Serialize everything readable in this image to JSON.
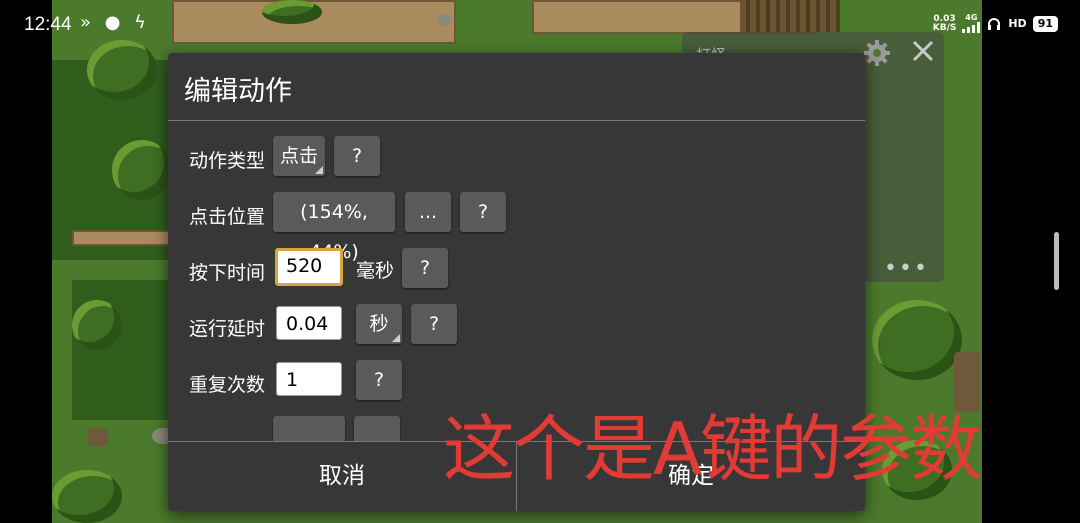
{
  "status_bar": {
    "time": "12:44",
    "left_icons": "» ● ϟ",
    "net_speed_value": "0.03",
    "net_speed_unit": "KB/S",
    "network_type": "4G",
    "hd_label": "HD",
    "battery": "91"
  },
  "background_panel": {
    "title": "打怪 ·"
  },
  "dialog": {
    "title": "编辑动作",
    "rows": [
      {
        "label": "动作类型",
        "value": "点击",
        "help": "?"
      },
      {
        "label": "点击位置",
        "value": "(154%, 44%)",
        "more": "...",
        "help": "?"
      },
      {
        "label": "按下时间",
        "value": "520",
        "unit": "毫秒",
        "help": "?"
      },
      {
        "label": "运行延时",
        "value": "0.04",
        "unit": "秒",
        "help": "?"
      },
      {
        "label": "重复次数",
        "value": "1",
        "help": "?"
      }
    ],
    "cancel": "取消",
    "confirm": "确定"
  },
  "overlay_caption": "这个是A键的参数",
  "colors": {
    "dialog_bg": "#373737",
    "button_bg": "#5a5a5a",
    "focus_border": "#d9a441",
    "caption": "#e23a34"
  }
}
